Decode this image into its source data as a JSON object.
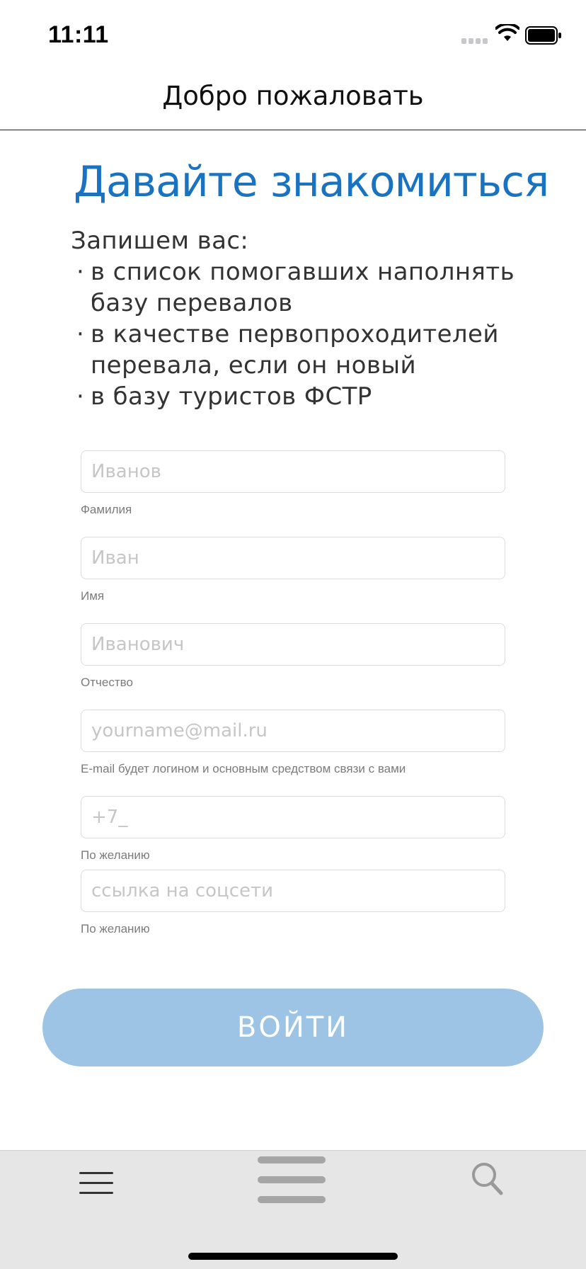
{
  "status_bar": {
    "time": "11:11"
  },
  "nav": {
    "title": "Добро пожаловать"
  },
  "main": {
    "headline": "Давайте знакомиться",
    "intro_lead": "Запишем вас:",
    "intro_items": [
      "в список помогавших наполнять базу перевалов",
      "в качестве первопроходителей перевала, если он новый",
      "в базу туристов ФСТР"
    ]
  },
  "form": {
    "fields": [
      {
        "placeholder": "Иванов",
        "hint": "Фамилия"
      },
      {
        "placeholder": "Иван",
        "hint": "Имя"
      },
      {
        "placeholder": "Иванович",
        "hint": "Отчество"
      },
      {
        "placeholder": "yourname@mail.ru",
        "hint": "E-mail будет логином и основным средством связи с вами"
      },
      {
        "placeholder": "+7_",
        "hint": "По желанию"
      },
      {
        "placeholder": "ссылка на соцсети",
        "hint": "По желанию"
      }
    ],
    "submit_label": "ВОЙТИ"
  },
  "toolbar": {
    "icons": [
      "menu-icon",
      "drag-handle-icon",
      "search-icon"
    ]
  },
  "colors": {
    "accent": "#1a73c1",
    "button_bg": "#9dc4e4",
    "toolbar_bg": "#e6e6e6"
  }
}
